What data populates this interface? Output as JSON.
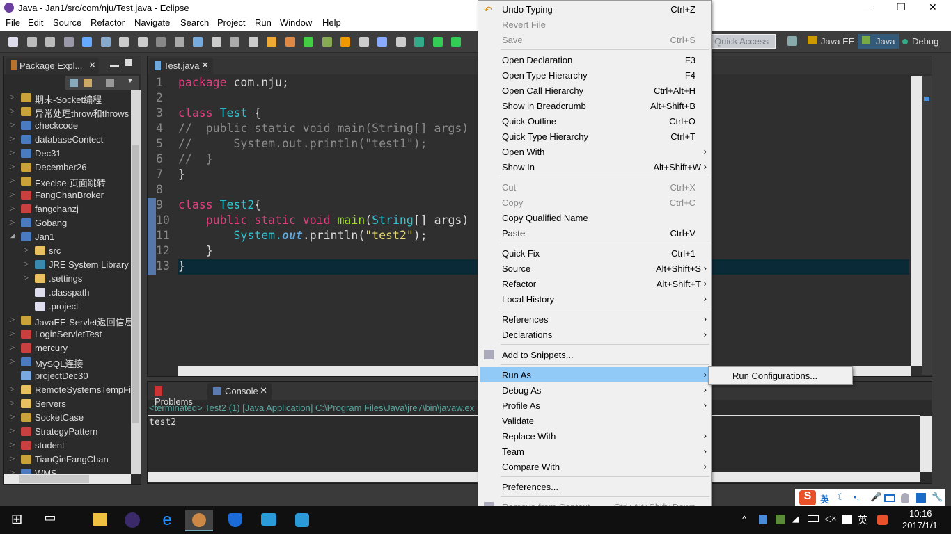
{
  "window": {
    "title": "Java - Jan1/src/com/nju/Test.java - Eclipse",
    "minimize": "—",
    "restore": "❐",
    "close": "✕"
  },
  "menubar": [
    "File",
    "Edit",
    "Source",
    "Refactor",
    "Navigate",
    "Search",
    "Project",
    "Run",
    "Window",
    "Help"
  ],
  "toolbar": {
    "quick_access_placeholder": "Quick Access",
    "perspectives": [
      "Java EE",
      "Java",
      "Debug"
    ],
    "active_perspective": "Java"
  },
  "package_explorer": {
    "title": "Package Expl...",
    "items": [
      {
        "label": "期末-Socket编程",
        "level": 0,
        "expand": "collapsed",
        "icon": "project-warning"
      },
      {
        "label": "异常处理throw和throws",
        "level": 0,
        "expand": "collapsed",
        "icon": "project-warning"
      },
      {
        "label": "checkcode",
        "level": 0,
        "expand": "collapsed",
        "icon": "project"
      },
      {
        "label": "databaseContect",
        "level": 0,
        "expand": "collapsed",
        "icon": "project"
      },
      {
        "label": "Dec31",
        "level": 0,
        "expand": "collapsed",
        "icon": "project"
      },
      {
        "label": "December26",
        "level": 0,
        "expand": "collapsed",
        "icon": "project-warning"
      },
      {
        "label": "Execise-页面跳转",
        "level": 0,
        "expand": "collapsed",
        "icon": "project-warning"
      },
      {
        "label": "FangChanBroker",
        "level": 0,
        "expand": "collapsed",
        "icon": "project-error"
      },
      {
        "label": "fangchanzj",
        "level": 0,
        "expand": "collapsed",
        "icon": "project-error"
      },
      {
        "label": "Gobang",
        "level": 0,
        "expand": "collapsed",
        "icon": "project"
      },
      {
        "label": "Jan1",
        "level": 0,
        "expand": "expanded",
        "icon": "project"
      },
      {
        "label": "src",
        "level": 1,
        "expand": "collapsed",
        "icon": "folder"
      },
      {
        "label": "JRE System Library [",
        "level": 1,
        "expand": "collapsed",
        "icon": "library"
      },
      {
        "label": ".settings",
        "level": 1,
        "expand": "collapsed",
        "icon": "folder"
      },
      {
        "label": ".classpath",
        "level": 1,
        "expand": "none",
        "icon": "xml-file"
      },
      {
        "label": ".project",
        "level": 1,
        "expand": "none",
        "icon": "xml-file"
      },
      {
        "label": "JavaEE-Servlet返回信息",
        "level": 0,
        "expand": "collapsed",
        "icon": "project-warning"
      },
      {
        "label": "LoginServletTest",
        "level": 0,
        "expand": "collapsed",
        "icon": "project-error"
      },
      {
        "label": "mercury",
        "level": 0,
        "expand": "collapsed",
        "icon": "project-error"
      },
      {
        "label": "MySQL连接",
        "level": 0,
        "expand": "collapsed",
        "icon": "project"
      },
      {
        "label": "projectDec30",
        "level": 0,
        "expand": "none",
        "icon": "closed-project"
      },
      {
        "label": "RemoteSystemsTempFil",
        "level": 0,
        "expand": "collapsed",
        "icon": "folder"
      },
      {
        "label": "Servers",
        "level": 0,
        "expand": "collapsed",
        "icon": "folder"
      },
      {
        "label": "SocketCase",
        "level": 0,
        "expand": "collapsed",
        "icon": "project-warning"
      },
      {
        "label": "StrategyPattern",
        "level": 0,
        "expand": "collapsed",
        "icon": "project-error"
      },
      {
        "label": "student",
        "level": 0,
        "expand": "collapsed",
        "icon": "project-error"
      },
      {
        "label": "TianQinFangChan",
        "level": 0,
        "expand": "collapsed",
        "icon": "project-warning"
      },
      {
        "label": "WMS",
        "level": 0,
        "expand": "collapsed",
        "icon": "project"
      }
    ]
  },
  "editor": {
    "tab": "Test.java",
    "lines": [
      [
        [
          "package ",
          "kw"
        ],
        [
          "com.nju;",
          "pl"
        ]
      ],
      [],
      [
        [
          "class ",
          "kw"
        ],
        [
          "Test",
          "ty"
        ],
        [
          " {",
          "pl"
        ]
      ],
      [
        [
          "//  public static void main(String[] args)",
          "cm"
        ]
      ],
      [
        [
          "//      System.out.println(\"test1\");",
          "cm"
        ]
      ],
      [
        [
          "//  }",
          "cm"
        ]
      ],
      [
        [
          "}",
          "pl"
        ]
      ],
      [],
      [
        [
          "class ",
          "kw"
        ],
        [
          "Test2",
          "ty"
        ],
        [
          "{",
          "pl"
        ]
      ],
      [
        [
          "    public static void ",
          "kw"
        ],
        [
          "main",
          "me"
        ],
        [
          "(",
          "pl"
        ],
        [
          "String",
          "ty"
        ],
        [
          "[] args)",
          "pl"
        ]
      ],
      [
        [
          "        System.",
          "ty"
        ],
        [
          "out",
          "fi"
        ],
        [
          ".println(",
          "pl"
        ],
        [
          "\"test2\"",
          "st"
        ],
        [
          ");",
          "pl"
        ]
      ],
      [
        [
          "    }",
          "pl"
        ]
      ],
      [
        [
          "}",
          "pl"
        ]
      ]
    ]
  },
  "bottom": {
    "tabs": [
      "Problems",
      "Console"
    ],
    "active": "Console",
    "status": "<terminated> Test2 (1) [Java Application] C:\\Program Files\\Java\\jre7\\bin\\javaw.ex",
    "output": "test2"
  },
  "context_menu": [
    {
      "label": "Undo Typing",
      "shortcut": "Ctrl+Z",
      "icon": "undo"
    },
    {
      "label": "Revert File",
      "disabled": true
    },
    {
      "label": "Save",
      "shortcut": "Ctrl+S",
      "disabled": true
    },
    "sep",
    {
      "label": "Open Declaration",
      "shortcut": "F3"
    },
    {
      "label": "Open Type Hierarchy",
      "shortcut": "F4"
    },
    {
      "label": "Open Call Hierarchy",
      "shortcut": "Ctrl+Alt+H"
    },
    {
      "label": "Show in Breadcrumb",
      "shortcut": "Alt+Shift+B"
    },
    {
      "label": "Quick Outline",
      "shortcut": "Ctrl+O"
    },
    {
      "label": "Quick Type Hierarchy",
      "shortcut": "Ctrl+T"
    },
    {
      "label": "Open With",
      "submenu": true
    },
    {
      "label": "Show In",
      "shortcut": "Alt+Shift+W",
      "submenu": true
    },
    "sep",
    {
      "label": "Cut",
      "shortcut": "Ctrl+X",
      "disabled": true
    },
    {
      "label": "Copy",
      "shortcut": "Ctrl+C",
      "disabled": true
    },
    {
      "label": "Copy Qualified Name"
    },
    {
      "label": "Paste",
      "shortcut": "Ctrl+V"
    },
    "sep",
    {
      "label": "Quick Fix",
      "shortcut": "Ctrl+1"
    },
    {
      "label": "Source",
      "shortcut": "Alt+Shift+S",
      "submenu": true
    },
    {
      "label": "Refactor",
      "shortcut": "Alt+Shift+T",
      "submenu": true
    },
    {
      "label": "Local History",
      "submenu": true
    },
    "sep",
    {
      "label": "References",
      "submenu": true
    },
    {
      "label": "Declarations",
      "submenu": true
    },
    "sep",
    {
      "label": "Add to Snippets...",
      "icon": "snippet"
    },
    "sep",
    {
      "label": "Run As",
      "submenu": true,
      "highlighted": true
    },
    {
      "label": "Debug As",
      "submenu": true
    },
    {
      "label": "Profile As",
      "submenu": true
    },
    {
      "label": "Validate"
    },
    {
      "label": "Replace With",
      "submenu": true
    },
    {
      "label": "Team",
      "submenu": true
    },
    {
      "label": "Compare With",
      "submenu": true
    },
    "sep",
    {
      "label": "Preferences..."
    },
    "sep",
    {
      "label": "Remove from Context",
      "shortcut": "Ctrl+Alt+Shift+Down",
      "disabled": true,
      "icon": "remove-context"
    }
  ],
  "submenu": {
    "label": "Run Configurations..."
  },
  "ime": {
    "lang": "英"
  },
  "taskbar": {
    "time": "10:16",
    "date": "2017/1/1",
    "lang": "英"
  },
  "colors": {
    "accent": "#91c9f7",
    "editor_bg": "#2f2f2f"
  }
}
